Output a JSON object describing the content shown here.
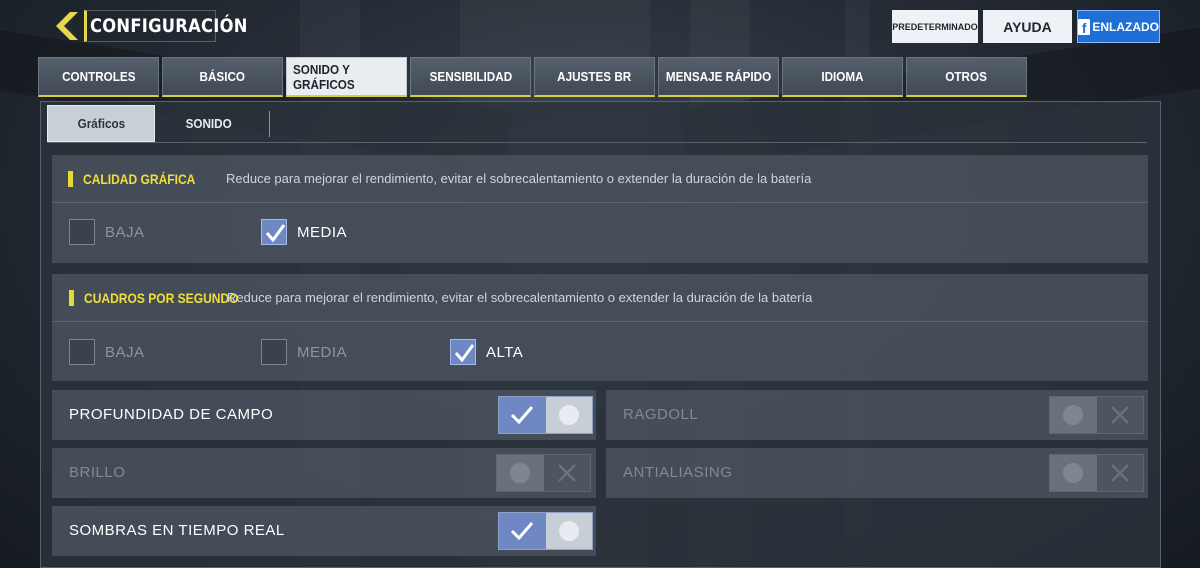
{
  "header": {
    "title": "CONFIGURACIÓN",
    "default_button": "PREDETERMINADO",
    "help_button": "AYUDA",
    "facebook_icon": "f",
    "facebook_button": "ENLAZADO",
    "accent_color": "#e6d84a"
  },
  "tabs": [
    {
      "label": "CONTROLES",
      "active": false
    },
    {
      "label": "BÁSICO",
      "active": false
    },
    {
      "label": "SONIDO Y GRÁFICOS",
      "active": true
    },
    {
      "label": "SENSIBILIDAD",
      "active": false
    },
    {
      "label": "AJUSTES BR",
      "active": false
    },
    {
      "label": "MENSAJE RÁPIDO",
      "active": false
    },
    {
      "label": "IDIOMA",
      "active": false
    },
    {
      "label": "OTROS",
      "active": false
    }
  ],
  "subtabs": [
    {
      "label": "Gráficos",
      "active": true
    },
    {
      "label": "SONIDO",
      "active": false
    }
  ],
  "quality": {
    "title": "CALIDAD GRÁFICA",
    "description": "Reduce para mejorar el rendimiento, evitar el sobrecalentamiento o extender la duración de la batería",
    "options": [
      {
        "label": "BAJA",
        "checked": false
      },
      {
        "label": "MEDIA",
        "checked": true
      }
    ]
  },
  "fps": {
    "title": "CUADROS POR SEGUNDO",
    "description": "Reduce para mejorar el rendimiento, evitar el sobrecalentamiento o extender la duración de la batería",
    "options": [
      {
        "label": "BAJA",
        "checked": false
      },
      {
        "label": "MEDIA",
        "checked": false
      },
      {
        "label": "ALTA",
        "checked": true
      }
    ]
  },
  "toggles": {
    "depth_of_field": {
      "label": "PROFUNDIDAD DE CAMPO",
      "on": true,
      "enabled": true
    },
    "ragdoll": {
      "label": "RAGDOLL",
      "on": false,
      "enabled": false
    },
    "brightness": {
      "label": "BRILLO",
      "on": false,
      "enabled": false
    },
    "antialiasing": {
      "label": "ANTIALIASING",
      "on": false,
      "enabled": false
    },
    "realtime_shadows": {
      "label": "SOMBRAS EN TIEMPO REAL",
      "on": true,
      "enabled": true
    }
  }
}
